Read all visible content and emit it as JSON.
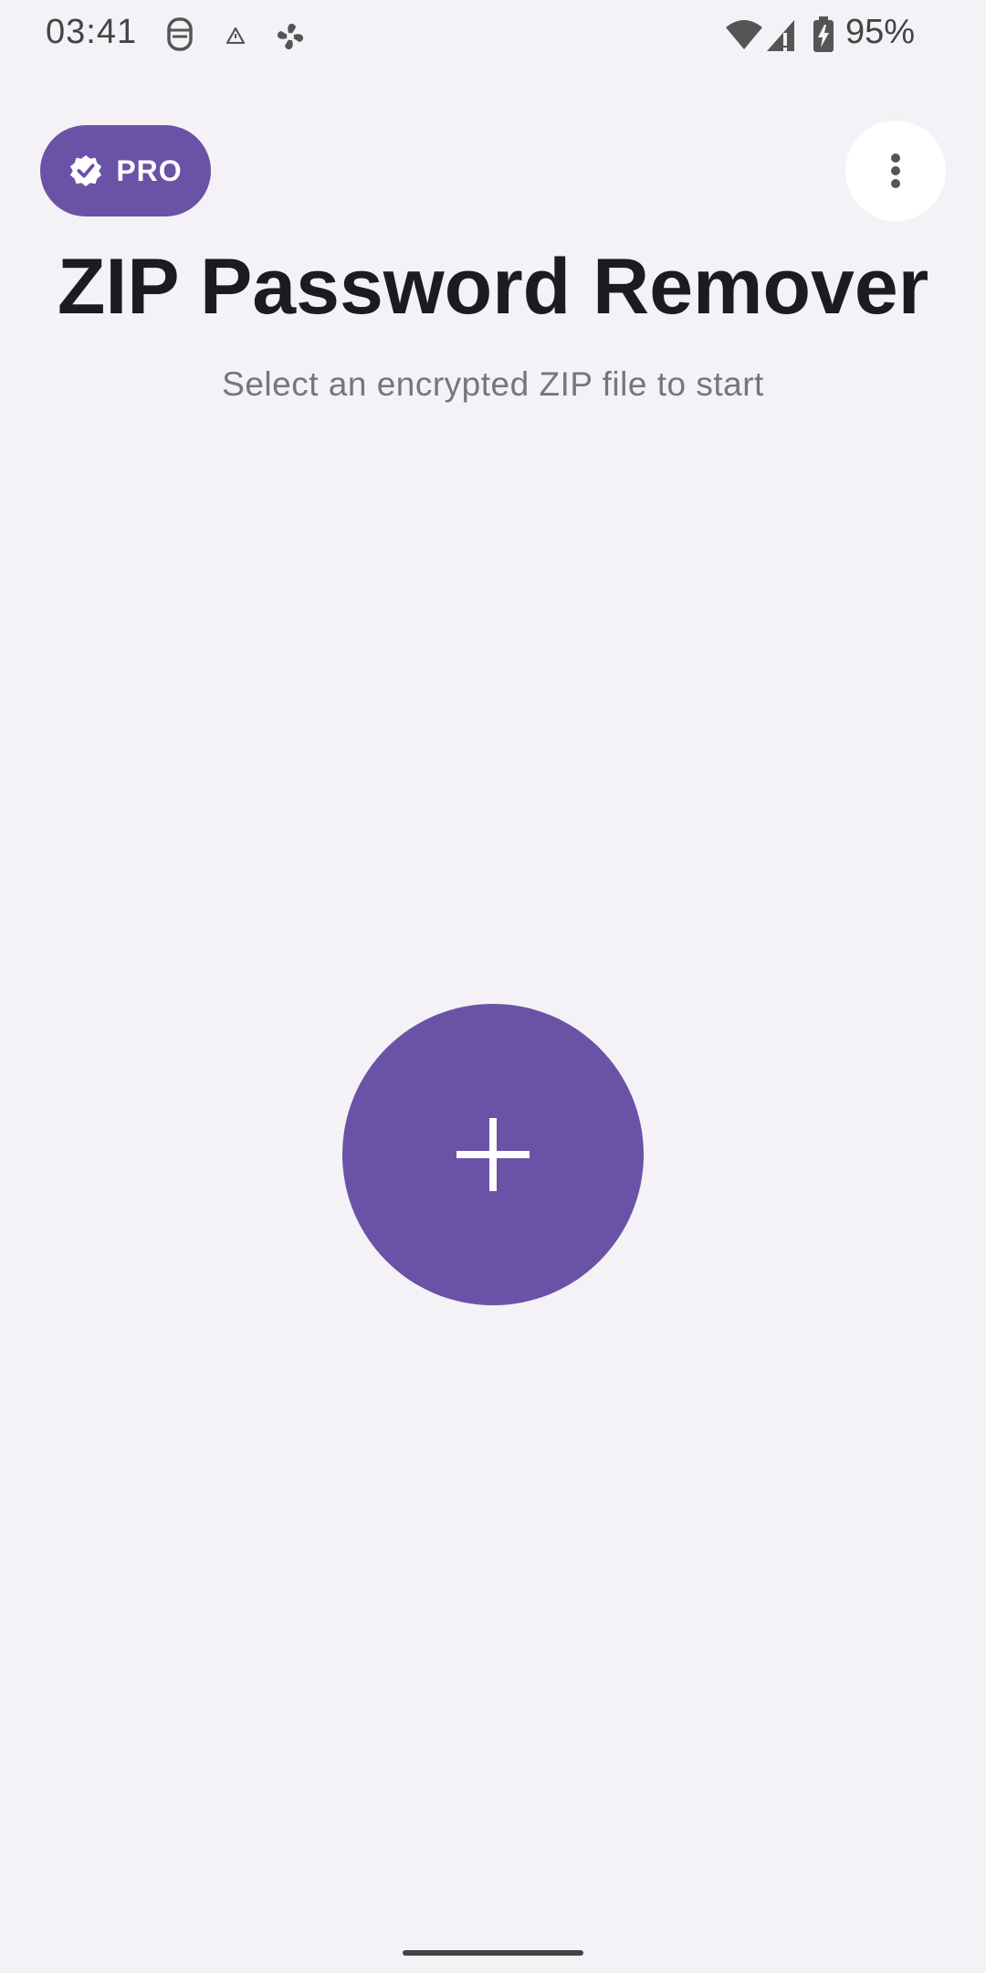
{
  "status_bar": {
    "time": "03:41",
    "battery_percent": "95%",
    "icons": [
      "face-mask-icon",
      "warning-icon",
      "pinwheel-icon",
      "wifi-icon",
      "cell-signal-icon",
      "battery-charging-icon"
    ]
  },
  "header": {
    "pro_label": "PRO",
    "pro_icon": "verified-icon",
    "menu_icon": "more-vert-icon"
  },
  "main": {
    "title": "ZIP Password Remover",
    "subtitle": "Select an encrypted ZIP file to start",
    "add_icon": "plus-icon"
  },
  "colors": {
    "accent": "#6a52a6",
    "background": "#f4f2f6",
    "title": "#1c1b1f",
    "subtitle": "#77757b"
  }
}
